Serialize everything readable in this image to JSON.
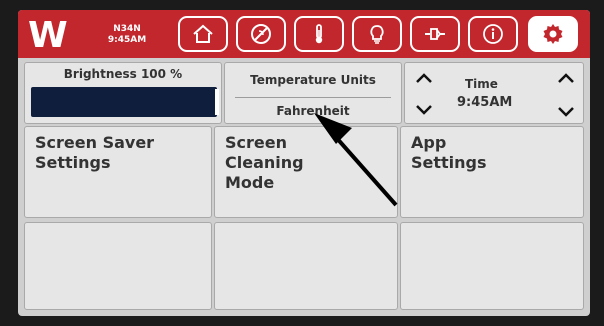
{
  "header": {
    "logo_letter": "W",
    "device_id": "N34N",
    "clock": "9:45AM",
    "nav_items": [
      {
        "name": "home",
        "icon": "home-icon"
      },
      {
        "name": "screen-saver",
        "icon": "no-screen-saver-icon"
      },
      {
        "name": "temperature",
        "icon": "thermometer-icon"
      },
      {
        "name": "lighting",
        "icon": "lightbulb-icon"
      },
      {
        "name": "connection",
        "icon": "plug-icon"
      },
      {
        "name": "info",
        "icon": "info-icon"
      },
      {
        "name": "settings",
        "icon": "gear-icon",
        "active": true
      }
    ]
  },
  "brightness": {
    "label": "Brightness 100 %",
    "level_percent": 100
  },
  "temperature": {
    "title": "Temperature Units",
    "value": "Fahrenheit"
  },
  "time": {
    "title": "Time",
    "value": "9:45AM"
  },
  "tiles": {
    "screen_saver": "Screen Saver\nSettings",
    "screen_cleaning": "Screen\nCleaning\nMode",
    "app_settings": "App\nSettings"
  },
  "colors": {
    "brand_red": "#c1272d",
    "panel_bg": "#e6e6e6",
    "bar_fill": "#0f1e3d"
  }
}
